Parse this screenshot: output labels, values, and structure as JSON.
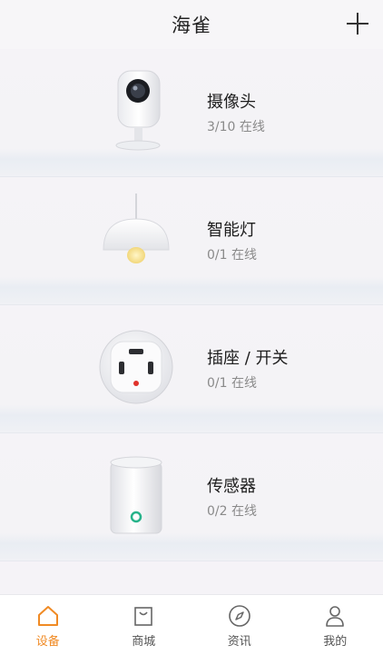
{
  "header": {
    "title": "海雀"
  },
  "devices": [
    {
      "name": "摄像头",
      "status": "3/10 在线",
      "icon": "camera-icon"
    },
    {
      "name": "智能灯",
      "status": "0/1 在线",
      "icon": "lamp-icon"
    },
    {
      "name": "插座 / 开关",
      "status": "0/1 在线",
      "icon": "socket-icon"
    },
    {
      "name": "传感器",
      "status": "0/2 在线",
      "icon": "sensor-icon"
    }
  ],
  "tabs": [
    {
      "label": "设备",
      "icon": "home-icon",
      "active": true
    },
    {
      "label": "商城",
      "icon": "shopping-bag-icon",
      "active": false
    },
    {
      "label": "资讯",
      "icon": "compass-icon",
      "active": false
    },
    {
      "label": "我的",
      "icon": "user-icon",
      "active": false
    }
  ],
  "colors": {
    "accent": "#f08a24",
    "background": "#f6f5f7",
    "text_primary": "#1e1e1e",
    "text_secondary": "#8a8a8a"
  }
}
